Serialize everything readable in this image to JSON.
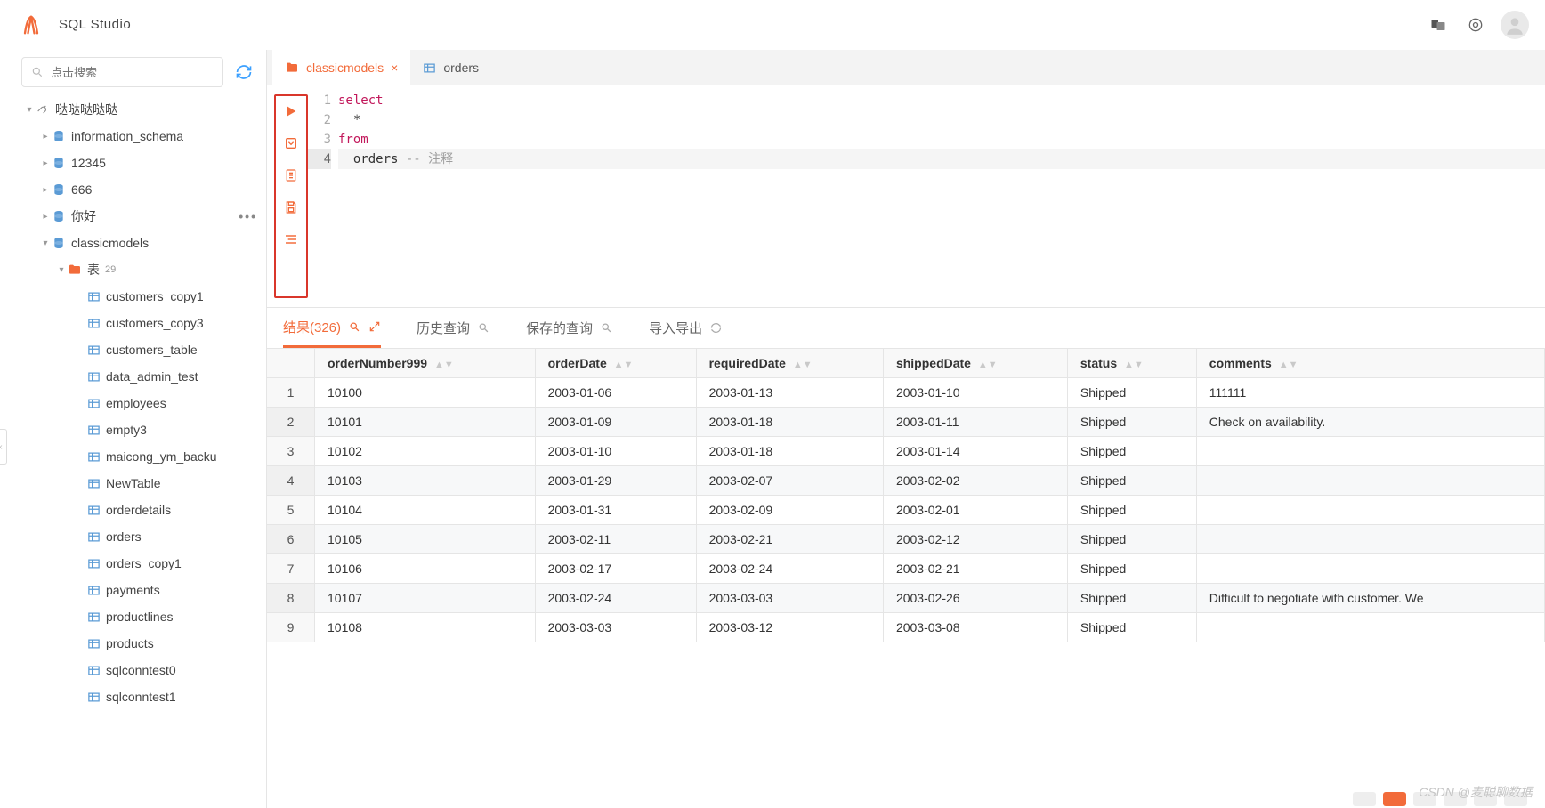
{
  "app": {
    "title": "SQL Studio"
  },
  "search": {
    "placeholder": "点击搜索"
  },
  "tree": {
    "connection": {
      "label": "哒哒哒哒哒"
    },
    "databases": [
      {
        "label": "information_schema"
      },
      {
        "label": "12345"
      },
      {
        "label": "666"
      },
      {
        "label": "你好"
      }
    ],
    "current_db": {
      "label": "classicmodels"
    },
    "tables_folder": {
      "label": "表",
      "count": "29"
    },
    "tables": [
      "customers_copy1",
      "customers_copy3",
      "customers_table",
      "data_admin_test",
      "employees",
      "empty3",
      "maicong_ym_backu",
      "NewTable",
      "orderdetails",
      "orders",
      "orders_copy1",
      "payments",
      "productlines",
      "products",
      "sqlconntest0",
      "sqlconntest1"
    ]
  },
  "tabs": [
    {
      "label": "classicmodels",
      "active": true,
      "closable": true
    },
    {
      "label": "orders",
      "active": false,
      "closable": false
    }
  ],
  "editor": {
    "lines": [
      {
        "n": "1",
        "tokens": [
          {
            "t": "select",
            "c": "kw"
          }
        ]
      },
      {
        "n": "2",
        "tokens": [
          {
            "t": "  *",
            "c": ""
          }
        ]
      },
      {
        "n": "3",
        "tokens": [
          {
            "t": "from",
            "c": "kw"
          }
        ]
      },
      {
        "n": "4",
        "tokens": [
          {
            "t": "  orders ",
            "c": ""
          },
          {
            "t": "-- 注释",
            "c": "cm"
          }
        ],
        "current": true
      }
    ]
  },
  "results": {
    "tabs": {
      "result": "结果(326)",
      "history": "历史查询",
      "saved": "保存的查询",
      "import_export": "导入导出"
    },
    "columns": [
      "orderNumber999",
      "orderDate",
      "requiredDate",
      "shippedDate",
      "status",
      "comments"
    ],
    "rows": [
      {
        "n": "1",
        "cells": [
          "10100",
          "2003-01-06",
          "2003-01-13",
          "2003-01-10",
          "Shipped",
          "111111"
        ]
      },
      {
        "n": "2",
        "cells": [
          "10101",
          "2003-01-09",
          "2003-01-18",
          "2003-01-11",
          "Shipped",
          "Check on availability."
        ]
      },
      {
        "n": "3",
        "cells": [
          "10102",
          "2003-01-10",
          "2003-01-18",
          "2003-01-14",
          "Shipped",
          ""
        ]
      },
      {
        "n": "4",
        "cells": [
          "10103",
          "2003-01-29",
          "2003-02-07",
          "2003-02-02",
          "Shipped",
          ""
        ]
      },
      {
        "n": "5",
        "cells": [
          "10104",
          "2003-01-31",
          "2003-02-09",
          "2003-02-01",
          "Shipped",
          ""
        ]
      },
      {
        "n": "6",
        "cells": [
          "10105",
          "2003-02-11",
          "2003-02-21",
          "2003-02-12",
          "Shipped",
          ""
        ]
      },
      {
        "n": "7",
        "cells": [
          "10106",
          "2003-02-17",
          "2003-02-24",
          "2003-02-21",
          "Shipped",
          ""
        ]
      },
      {
        "n": "8",
        "cells": [
          "10107",
          "2003-02-24",
          "2003-03-03",
          "2003-02-26",
          "Shipped",
          "Difficult to negotiate with customer. We"
        ]
      },
      {
        "n": "9",
        "cells": [
          "10108",
          "2003-03-03",
          "2003-03-12",
          "2003-03-08",
          "Shipped",
          ""
        ]
      }
    ]
  },
  "watermark": "CSDN @麦聪聊数据"
}
